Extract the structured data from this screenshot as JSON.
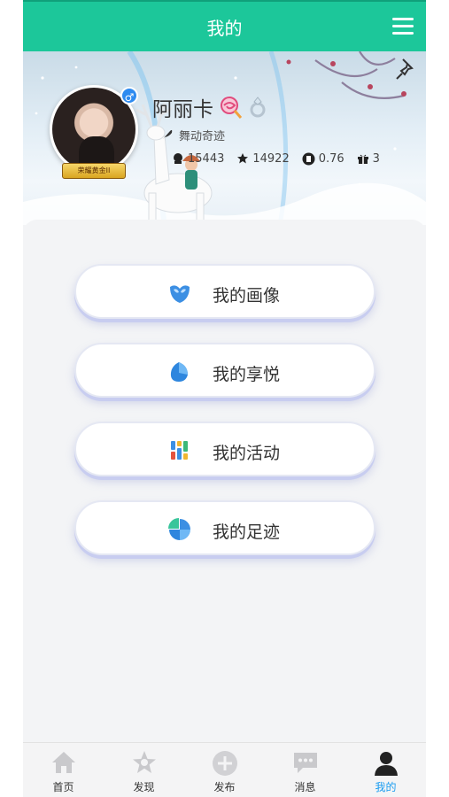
{
  "header": {
    "title": "我的"
  },
  "profile": {
    "name": "阿丽卡",
    "signature": "舞动奇迹",
    "rank_label": "荣耀黄金II",
    "stats": [
      {
        "icon": "coin-icon",
        "value": "15443"
      },
      {
        "icon": "star-icon",
        "value": "14922"
      },
      {
        "icon": "yue-badge-icon",
        "value": "0.76"
      },
      {
        "icon": "gift-icon",
        "value": "3"
      }
    ]
  },
  "menu": [
    {
      "label": "我的画像",
      "icon": "portrait-icon"
    },
    {
      "label": "我的享悦",
      "icon": "joy-icon"
    },
    {
      "label": "我的活动",
      "icon": "activity-icon"
    },
    {
      "label": "我的足迹",
      "icon": "footprint-icon"
    }
  ],
  "tabs": [
    {
      "label": "首页",
      "icon": "home-icon"
    },
    {
      "label": "发现",
      "icon": "discover-icon"
    },
    {
      "label": "发布",
      "icon": "publish-icon"
    },
    {
      "label": "消息",
      "icon": "message-icon"
    },
    {
      "label": "我的",
      "icon": "person-icon",
      "active": true
    }
  ],
  "colors": {
    "header": "#1cc79a",
    "active_tab": "#1a9cf0"
  }
}
